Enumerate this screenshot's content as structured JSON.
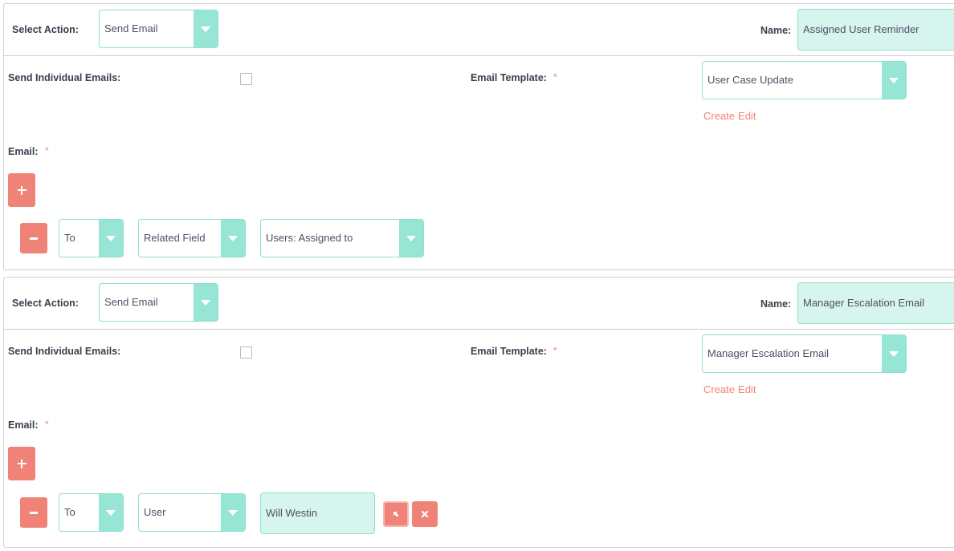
{
  "actions": [
    {
      "select_action_label": "Select Action:",
      "select_action_value": "Send Email",
      "name_label": "Name:",
      "name_value": "Assigned User Reminder",
      "send_individual_label": "Send Individual Emails:",
      "send_individual_checked": false,
      "email_template_label": "Email Template:",
      "required_mark": "*",
      "email_template_value": "User Case Update",
      "create_link": "Create",
      "edit_link": "Edit",
      "email_label": "Email:",
      "recipient": {
        "type": "To",
        "source": "Related Field",
        "value": "Users: Assigned to"
      }
    },
    {
      "select_action_label": "Select Action:",
      "select_action_value": "Send Email",
      "name_label": "Name:",
      "name_value": "Manager Escalation Email",
      "send_individual_label": "Send Individual Emails:",
      "send_individual_checked": false,
      "email_template_label": "Email Template:",
      "required_mark": "*",
      "email_template_value": "Manager Escalation Email",
      "create_link": "Create",
      "edit_link": "Edit",
      "email_label": "Email:",
      "recipient": {
        "type": "To",
        "source": "User",
        "value": "Will Westin"
      }
    }
  ],
  "icons": {
    "caret": "caret-down-icon",
    "add": "plus-icon",
    "remove": "minus-icon",
    "select": "arrow-select-icon",
    "clear": "close-icon"
  },
  "colors": {
    "accent": "#97e6d5",
    "accent_light": "#d6f5ee",
    "action": "#f08377"
  }
}
